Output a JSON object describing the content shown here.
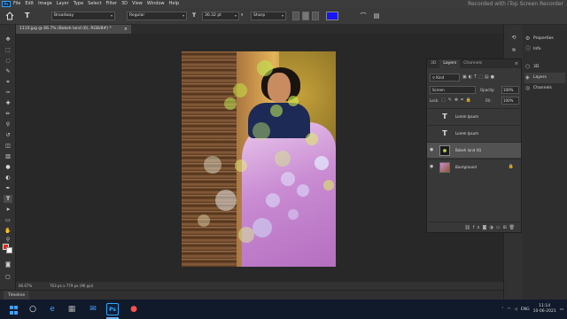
{
  "app": {
    "logo": "Ps",
    "menu": [
      "File",
      "Edit",
      "Image",
      "Layer",
      "Type",
      "Select",
      "Filter",
      "3D",
      "View",
      "Window",
      "Help"
    ],
    "watermark": "Recorded with iTop Screen Recorder"
  },
  "options_bar": {
    "font_family": "Broadway",
    "font_style": "Regular",
    "font_size": "30.32 pt",
    "antialias": "Sharp",
    "text_color": "#1717ff"
  },
  "document": {
    "tab_title": "1110.jpg @ 66.7% (Bokeh land (6), RGB/8#) *",
    "close_glyph": "×"
  },
  "status": {
    "zoom": "66.67%",
    "doc_info": "763 px x 779 px (96 ppi)"
  },
  "timeline": {
    "label": "Timeline"
  },
  "right_panels": {
    "items": [
      "Properties",
      "Info",
      "3D",
      "Layers",
      "Channels"
    ]
  },
  "layers_panel": {
    "tabs": [
      "3D",
      "Layers",
      "Channels"
    ],
    "kind": "Kind",
    "blend_mode": "Screen",
    "opacity_label": "Opacity:",
    "opacity": "100%",
    "lock_label": "Lock:",
    "fill_label": "Fill:",
    "fill": "100%",
    "layers": [
      {
        "name": "Lorem Ipsum",
        "type": "text",
        "visible": false
      },
      {
        "name": "Lorem Ipsum",
        "type": "text",
        "visible": false
      },
      {
        "name": "Bokeh land (6)",
        "type": "image",
        "visible": true
      },
      {
        "name": "Background",
        "type": "image",
        "visible": true
      }
    ]
  },
  "taskbar": {
    "lang": "ENG",
    "time": "11:14",
    "date": "10-06-2021"
  }
}
